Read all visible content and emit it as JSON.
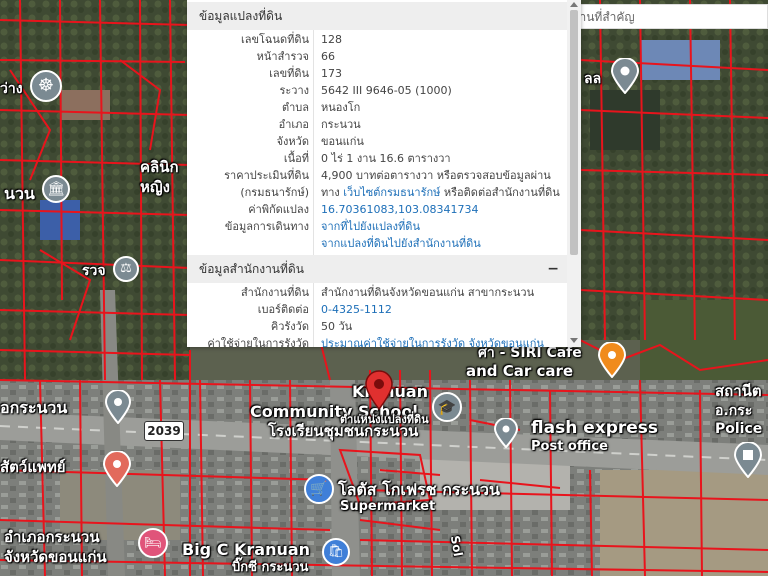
{
  "search": {
    "placeholder": "ค้นหาสถานที่สำคัญ"
  },
  "panel": {
    "parcel_section_title": "ข้อมูลแปลงที่ดิน",
    "parcel_rows": [
      {
        "label": "เลขโฉนดที่ดิน",
        "value": "128"
      },
      {
        "label": "หน้าสำรวจ",
        "value": "66"
      },
      {
        "label": "เลขที่ดิน",
        "value": "173"
      },
      {
        "label": "ระวาง",
        "value": "5642 III 9646-05 (1000)"
      },
      {
        "label": "ตำบล",
        "value": "หนองโก"
      },
      {
        "label": "อำเภอ",
        "value": "กระนวน"
      },
      {
        "label": "จังหวัด",
        "value": "ขอนแก่น"
      },
      {
        "label": "เนื้อที่",
        "value": "0 ไร่ 1 งาน 16.6 ตารางวา"
      },
      {
        "label": "ราคาประเมินที่ดิน",
        "value": "4,900 บาทต่อตารางวา หรือตรวจสอบข้อมูลผ่าน"
      },
      {
        "label": "(กรมธนารักษ์)",
        "value_prefix": "ทาง ",
        "value_link": "เว็บไซต์กรมธนารักษ์",
        "value_suffix": " หรือติดต่อสำนักงานที่ดิน"
      },
      {
        "label": "ค่าพิกัดแปลง",
        "value": "16.70361083,103.08341734"
      },
      {
        "label": "ข้อมูลการเดินทาง",
        "value": "จากที่ไปยังแปลงที่ดิน"
      },
      {
        "label": "",
        "value": "จากแปลงที่ดินไปยังสำนักงานที่ดิน"
      }
    ],
    "office_section_title": "ข้อมูลสำนักงานที่ดิน",
    "collapse_symbol": "−",
    "office_rows": [
      {
        "label": "สำนักงานที่ดิน",
        "value": "สำนักงานที่ดินจังหวัดขอนแก่น สาขากระนวน"
      },
      {
        "label": "เบอร์ติดต่อ",
        "value": "0-4325-1112"
      },
      {
        "label": "คิวรังวัด",
        "value": "50 วัน"
      },
      {
        "label": "ค่าใช้จ่ายในการรังวัด",
        "value": "ประมาณค่าใช้จ่ายในการรังวัด จังหวัดขอนแก่น"
      }
    ]
  },
  "map_labels": {
    "kranuan_top": "Kranuan",
    "community_school": "Community School",
    "school_thai": "โรงเรียนชุมชนกระนวน",
    "marker_label": "ตำแหน่งแปลงที่ดิน",
    "siri_cafe": "ศา - SIRI Cafe",
    "and_car_care": "and Car care",
    "flash_express": "flash express",
    "post_office": "Post office",
    "station_thai": "สถานีต",
    "district_abbr": "อ.กระ",
    "police": "Police",
    "lotus": "โลตัส โกเฟรช กระนวน",
    "supermarket": "Supermarket",
    "big_c": "Big C Kranuan",
    "big_c_thai": "บิ๊กซี กระนวน",
    "district_office": "อำเภอกระนวน",
    "province_office": "จังหวัดขอนแก่น",
    "kranuan_left": "อกระนวน",
    "vet": "สัตว์แพทย์",
    "road_2039": "2039",
    "clinic": "คลินิก",
    "clinic2": "หญิง",
    "nuan": "นวน",
    "ror_wor_jor": "รวจ",
    "wang": "ว่าง",
    "lo": "ลล",
    "sol": "Sol"
  },
  "colors": {
    "parcel_line": "#e8141c",
    "link": "#1d6fb8",
    "marker": "#e0302f"
  }
}
